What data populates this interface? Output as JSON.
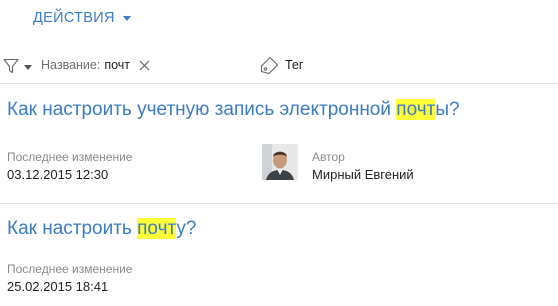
{
  "toolbar": {
    "actions_label": "ДЕЙСТВИЯ"
  },
  "filter": {
    "name_label": "Название:",
    "value": "почт",
    "tag_label": "Тег"
  },
  "articles": [
    {
      "title_before": "Как настроить учетную запись электронной ",
      "title_highlight": "почт",
      "title_after": "ы?",
      "modified_label": "Последнее изменение",
      "modified_value": "03.12.2015 12:30",
      "author_label": "Автор",
      "author_name": "Мирный Евгений"
    },
    {
      "title_before": "Как настроить ",
      "title_highlight": "почт",
      "title_after": "у?",
      "modified_label": "Последнее изменение",
      "modified_value": "25.02.2015 18:41"
    }
  ],
  "colors": {
    "link": "#3b7cc5",
    "highlight": "#ffff3a",
    "muted": "#8a8a8a"
  }
}
